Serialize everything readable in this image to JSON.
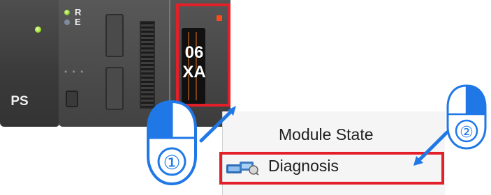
{
  "rack": {
    "ps_module": {
      "label": "PS"
    },
    "cpu_module": {
      "led_r_label": "R",
      "led_e_label": "E"
    },
    "io_module": {
      "line1": "06",
      "line2": "XA"
    }
  },
  "callouts": {
    "step1": {
      "number": "①"
    },
    "step2": {
      "number": "②"
    }
  },
  "context_menu": {
    "items": [
      {
        "label": "Module State",
        "icon": "none"
      },
      {
        "label": "Diagnosis",
        "icon": "diagnosis-icon"
      }
    ]
  },
  "colors": {
    "highlight": "#e3202a",
    "callout_blue": "#1f78e6",
    "menu_bg": "#f5f5f5"
  }
}
